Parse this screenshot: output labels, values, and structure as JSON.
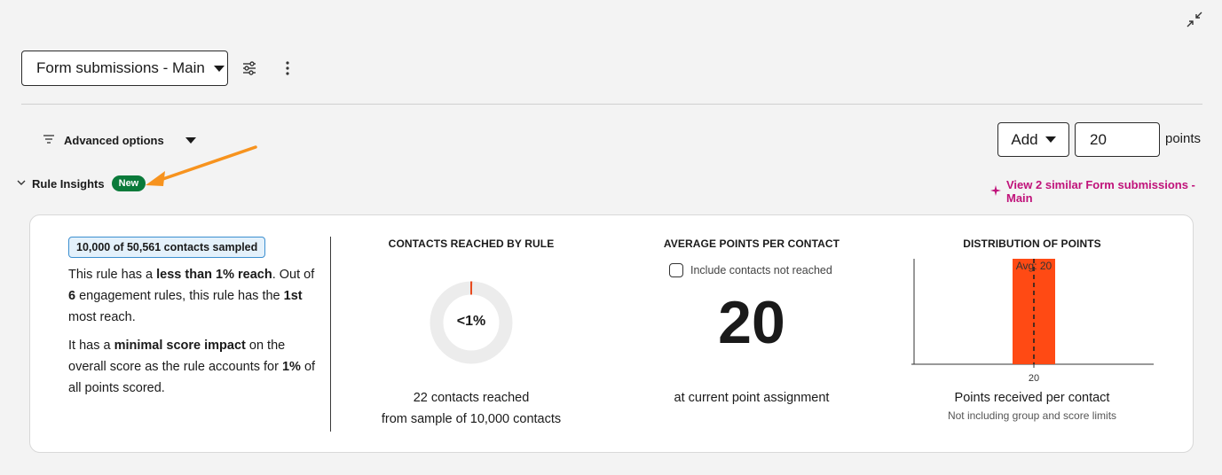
{
  "toolbar": {
    "collapse_icon": "collapse-icon",
    "rule_selector_label": "Form submissions - Main",
    "settings_icon": "sliders-icon",
    "more_icon": "kebab-menu-icon"
  },
  "options": {
    "advanced_label": "Advanced options",
    "filter_icon": "filter-icon"
  },
  "points": {
    "action_label": "Add",
    "value": "20",
    "unit_label": "points"
  },
  "insights": {
    "section_label": "Rule Insights",
    "new_badge": "New",
    "similar_link": "View 2 similar Form submissions - Main",
    "accent_color": "#c0127a"
  },
  "summary": {
    "sampled_badge": "10,000 of 50,561 contacts sampled",
    "reach_text_1": "This rule has a ",
    "reach_bold_1": "less than 1% reach",
    "reach_text_2": ". Out of ",
    "reach_bold_2": "6",
    "reach_text_3": " engagement rules, this rule has the ",
    "reach_bold_3": "1st",
    "reach_text_4": " most reach.",
    "impact_text_1": "It has a ",
    "impact_bold_1": "minimal score impact",
    "impact_text_2": " on the overall score as the rule accounts for ",
    "impact_bold_2": "1%",
    "impact_text_3": " of all points scored."
  },
  "contacts_reached": {
    "title": "CONTACTS REACHED BY RULE",
    "donut_label": "<1%",
    "reached_fraction": 0.0022,
    "line_1": "22 contacts reached",
    "line_2": "from sample of 10,000 contacts",
    "donut_fill_color": "#e84a1e",
    "donut_track_color": "#ececec"
  },
  "average_points": {
    "title": "AVERAGE POINTS PER CONTACT",
    "include_label": "Include contacts not reached",
    "include_checked": false,
    "value": "20",
    "caption": "at current point assignment"
  },
  "distribution": {
    "title": "DISTRIBUTION OF POINTS",
    "caption": "Points received per contact",
    "sub_caption": "Not including group and score limits",
    "bar_color": "#ff4a14"
  },
  "chart_data": {
    "type": "bar",
    "categories": [
      "20"
    ],
    "values": [
      1
    ],
    "title": "DISTRIBUTION OF POINTS",
    "xlabel": "Points received per contact",
    "ylabel": "",
    "ylim": [
      0,
      1
    ],
    "annotations": [
      {
        "text": "Avg: 20",
        "x": "20",
        "style": "dashed-vertical-line"
      }
    ],
    "grid": false
  }
}
